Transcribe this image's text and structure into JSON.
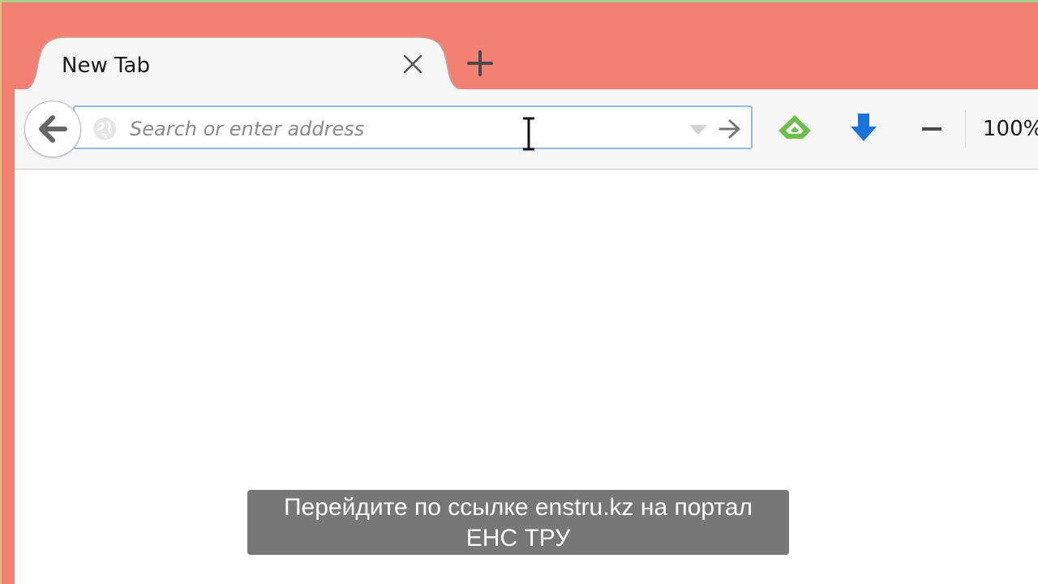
{
  "window": {
    "frame_color": "#f28073"
  },
  "tabs": [
    {
      "label": "New Tab",
      "active": true
    }
  ],
  "toolbar": {
    "address_bar": {
      "placeholder": "Search or enter address",
      "value": ""
    },
    "zoom_level": "100%",
    "icons": [
      "back-arrow-icon",
      "globe-icon",
      "dropdown-icon",
      "go-arrow-icon",
      "feedly-icon",
      "download-icon",
      "zoom-out-icon",
      "new-tab-plus-icon",
      "close-icon"
    ]
  },
  "subtitle": {
    "line1": "Перейдите по ссылке enstru.kz на портал",
    "line2": "ЕНС ТРУ"
  },
  "colors": {
    "url_border": "#8ebce6",
    "download_blue": "#1a73d9",
    "feedly_green": "#6cc04a"
  }
}
